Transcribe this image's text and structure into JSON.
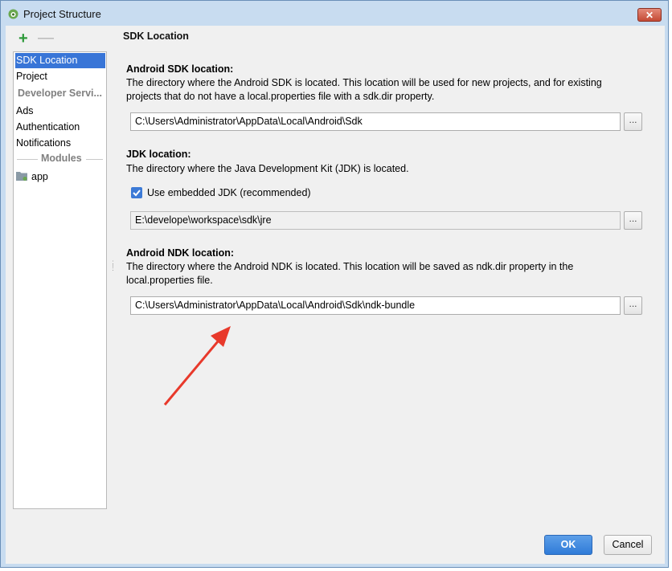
{
  "window": {
    "title": "Project Structure",
    "close_label": "✕"
  },
  "toolbar": {
    "add_label": "+",
    "remove_label": "—"
  },
  "sidebar": {
    "items": [
      {
        "label": "SDK Location"
      },
      {
        "label": "Project"
      },
      {
        "label": "Developer Servi..."
      },
      {
        "label": "Ads"
      },
      {
        "label": "Authentication"
      },
      {
        "label": "Notifications"
      },
      {
        "label": "Modules"
      },
      {
        "label": "app"
      }
    ]
  },
  "main": {
    "section_title": "SDK Location",
    "android_sdk": {
      "heading": "Android SDK location:",
      "desc_line1": "The directory where the Android SDK is located. This location will be used for new projects, and for existing",
      "desc_line2": "projects that do not have a local.properties file with a sdk.dir property.",
      "path": "C:\\Users\\Administrator\\AppData\\Local\\Android\\Sdk"
    },
    "jdk": {
      "heading": "JDK location:",
      "desc": "The directory where the Java Development Kit (JDK) is located.",
      "checkbox_label": "Use embedded JDK (recommended)",
      "checkbox_checked": true,
      "path": "E:\\develope\\workspace\\sdk\\jre"
    },
    "android_ndk": {
      "heading": "Android NDK location:",
      "desc_line1": "The directory where the Android NDK is located. This location will be saved as ndk.dir property in the",
      "desc_line2": "local.properties file.",
      "path": "C:\\Users\\Administrator\\AppData\\Local\\Android\\Sdk\\ndk-bundle"
    },
    "browse_label": "..."
  },
  "footer": {
    "ok_label": "OK",
    "cancel_label": "Cancel"
  },
  "colors": {
    "accent": "#3875d7",
    "arrow": "#e8392b",
    "add_green": "#2e9a3a"
  },
  "icons": [
    "android-icon",
    "close-icon",
    "plus-icon",
    "minus-icon",
    "folder-icon",
    "checkmark-icon",
    "annotation-arrow-icon"
  ]
}
